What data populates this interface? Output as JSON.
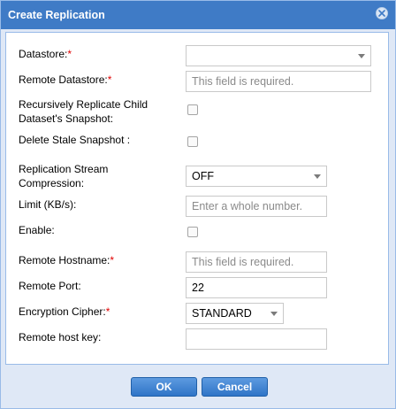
{
  "dialog": {
    "title": "Create Replication",
    "close_icon": "close-icon"
  },
  "form": {
    "required_marker": "*",
    "datastore": {
      "label": "Datastore:",
      "required": true,
      "value": ""
    },
    "remote_datastore": {
      "label": "Remote Datastore:",
      "required": true,
      "placeholder": "This field is required.",
      "value": ""
    },
    "recursive": {
      "label_line1": "Recursively Replicate Child",
      "label_line2": "Dataset's Snapshot:",
      "checked": false
    },
    "delete_stale": {
      "label": "Delete Stale Snapshot :",
      "checked": false
    },
    "compression": {
      "label_line1": "Replication Stream",
      "label_line2": "Compression:",
      "value": "OFF"
    },
    "limit": {
      "label": "Limit (KB/s):",
      "placeholder": "Enter a whole number.",
      "value": ""
    },
    "enable": {
      "label": "Enable:",
      "checked": false
    },
    "remote_hostname": {
      "label": "Remote Hostname:",
      "required": true,
      "placeholder": "This field is required.",
      "value": ""
    },
    "remote_port": {
      "label": "Remote Port:",
      "value": "22"
    },
    "cipher": {
      "label": "Encryption Cipher:",
      "required": true,
      "value": "STANDARD"
    },
    "remote_host_key": {
      "label": "Remote host key:",
      "value": ""
    }
  },
  "footer": {
    "ok_label": "OK",
    "cancel_label": "Cancel"
  },
  "colors": {
    "title_bar": "#3f7bc6",
    "dialog_bg": "#dfe8f6",
    "required": "#e00000",
    "button": "#2f74c7"
  }
}
